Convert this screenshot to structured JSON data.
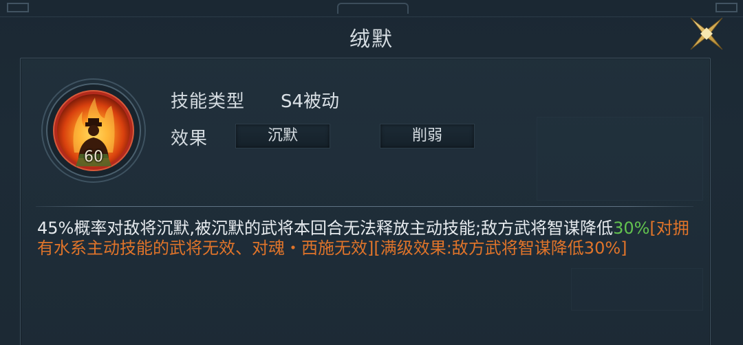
{
  "dialog": {
    "title": "绒默"
  },
  "skill": {
    "level": "60",
    "type_label": "技能类型",
    "type_value": "S4被动",
    "effect_label": "效果",
    "effect_tags": [
      "沉默",
      "削弱"
    ]
  },
  "description": {
    "part1": "45%概率对敌将沉默,被沉默的武将本回合无法释放主动技能;敌方武将智谋降低",
    "highlight_value": "30%",
    "note": "[对拥有水系主动技能的武将无效、对魂・西施无效][满级效果:敌方武将智谋降低30%]"
  },
  "colors": {
    "highlight_green": "#62c24f",
    "note_orange": "#e0742a",
    "close_gold": "#d8b45a"
  },
  "icons": {
    "close": "close-x-icon",
    "skill": "skill-portrait-icon"
  }
}
